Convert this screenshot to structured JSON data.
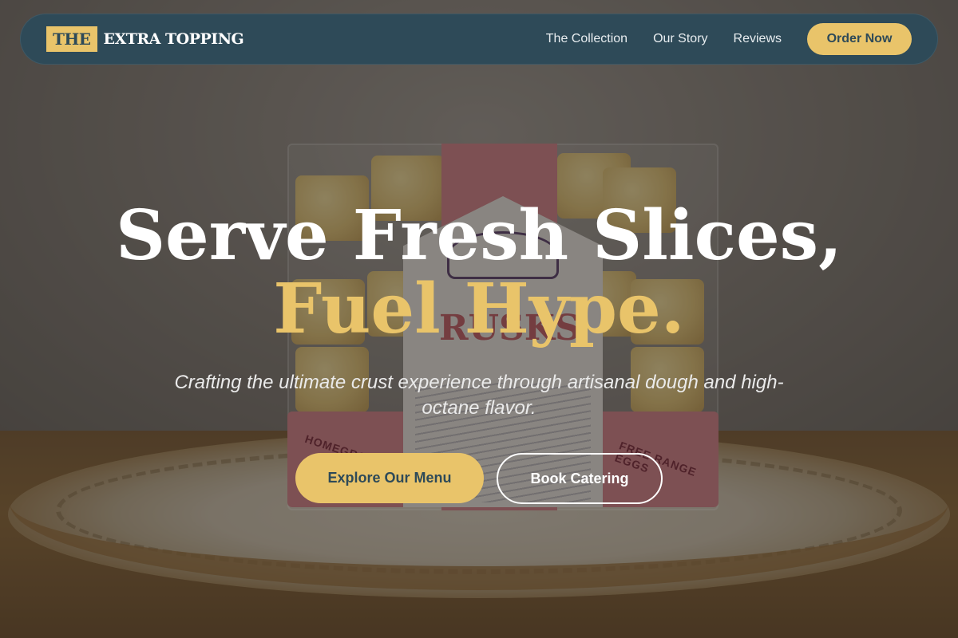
{
  "brand": {
    "logo_box": "THE",
    "logo_text": "EXTRA TOPPING",
    "accent_color": "#e9c46a",
    "nav_color": "#2e4a58"
  },
  "nav": {
    "links": [
      "The Collection",
      "Our Story",
      "Reviews"
    ],
    "order_label": "Order Now"
  },
  "hero": {
    "title_line1": "Serve Fresh Slices,",
    "title_line2": "Fuel Hype.",
    "subtitle": "Crafting the ultimate crust experience through artisanal dough and high-octane flavor.",
    "primary_cta": "Explore Our Menu",
    "secondary_cta": "Book Catering"
  },
  "background_photo": {
    "package_label": "RUSKS",
    "side_label_left": "HOMEGROWN",
    "side_label_right": "FREE RANGE EGGS"
  }
}
